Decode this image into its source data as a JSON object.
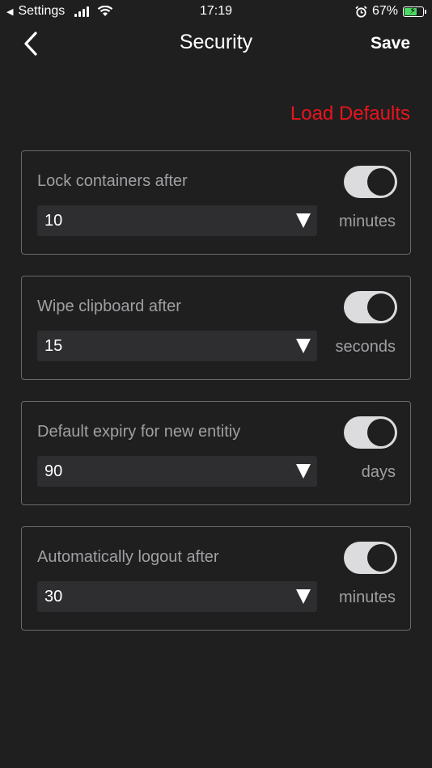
{
  "status_bar": {
    "back_app": "Settings",
    "time": "17:19",
    "battery_percent": "67%",
    "battery_level": 0.67
  },
  "nav": {
    "title": "Security",
    "save_label": "Save"
  },
  "load_defaults_label": "Load Defaults",
  "settings": [
    {
      "label": "Lock containers after",
      "value": "10",
      "unit": "minutes",
      "enabled": true
    },
    {
      "label": "Wipe clipboard after",
      "value": "15",
      "unit": "seconds",
      "enabled": true
    },
    {
      "label": "Default expiry for new entitiy",
      "value": "90",
      "unit": "days",
      "enabled": true
    },
    {
      "label": "Automatically logout after",
      "value": "30",
      "unit": "minutes",
      "enabled": true
    }
  ],
  "colors": {
    "background": "#1f1f20",
    "accent_red": "#e8141c",
    "toggle_on": "#dcdcde",
    "card_border": "#6a6a6c"
  }
}
